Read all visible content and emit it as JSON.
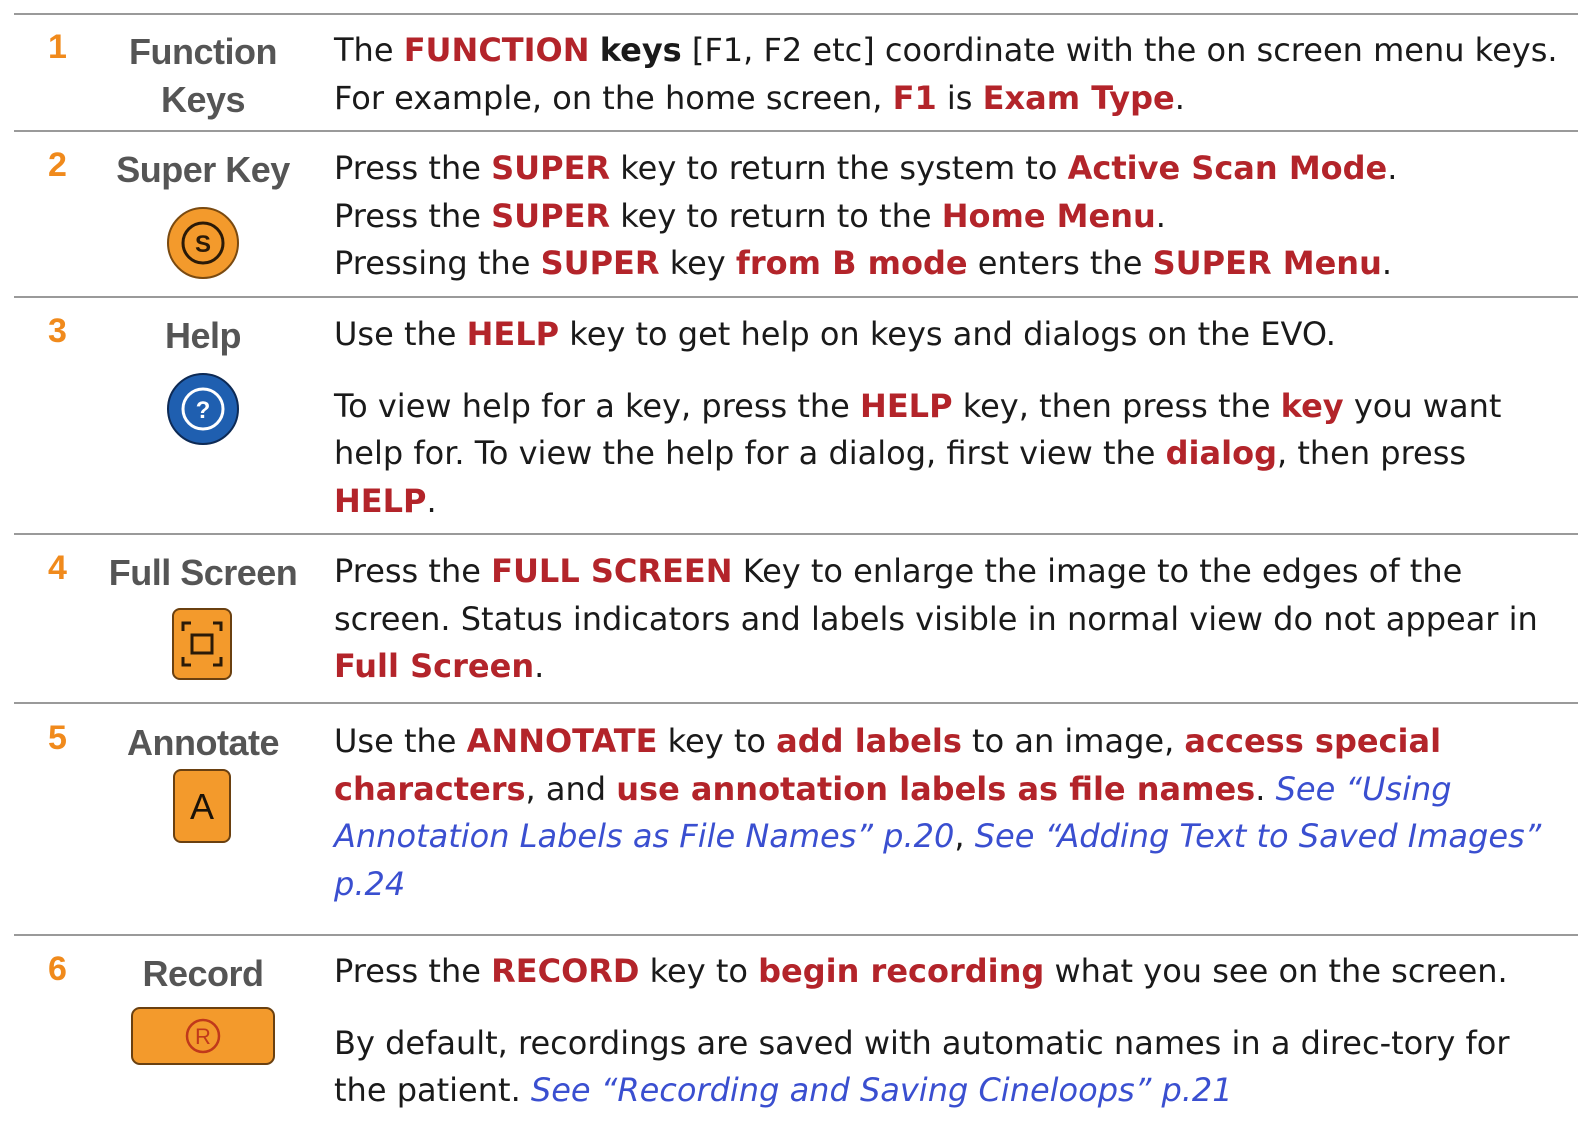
{
  "rows": [
    {
      "num": "1",
      "label_lines": [
        "Function",
        "Keys"
      ],
      "desc": [
        [
          {
            "t": "The ",
            "s": "n"
          },
          {
            "t": "FUNCTION",
            "s": "h"
          },
          {
            "t": " ",
            "s": "n"
          },
          {
            "t": "keys",
            "s": "b"
          },
          {
            "t": " [F1, F2 etc] coordinate with the on screen menu keys. For example, on the home screen, ",
            "s": "n"
          },
          {
            "t": "F1",
            "s": "h"
          },
          {
            "t": " is ",
            "s": "n"
          },
          {
            "t": "Exam Type",
            "s": "h"
          },
          {
            "t": ".",
            "s": "n"
          }
        ]
      ]
    },
    {
      "num": "2",
      "label_lines": [
        "Super Key"
      ],
      "icon": "super-key-icon",
      "icon_glyph": "S",
      "desc": [
        [
          {
            "t": "Press the ",
            "s": "n"
          },
          {
            "t": "SUPER",
            "s": "h"
          },
          {
            "t": " key to return the system to ",
            "s": "n"
          },
          {
            "t": "Active Scan Mode",
            "s": "h"
          },
          {
            "t": ".",
            "s": "n"
          },
          {
            "br": true
          },
          {
            "t": "Press the ",
            "s": "n"
          },
          {
            "t": "SUPER",
            "s": "h"
          },
          {
            "t": " key to return to the ",
            "s": "n"
          },
          {
            "t": "Home Menu",
            "s": "h"
          },
          {
            "t": ".",
            "s": "n"
          },
          {
            "br": true
          },
          {
            "t": "Pressing the ",
            "s": "n"
          },
          {
            "t": "SUPER",
            "s": "h"
          },
          {
            "t": " key ",
            "s": "n"
          },
          {
            "t": "from B mode",
            "s": "h"
          },
          {
            "t": " enters the ",
            "s": "n"
          },
          {
            "t": "SUPER Menu",
            "s": "h"
          },
          {
            "t": ".",
            "s": "n"
          }
        ]
      ]
    },
    {
      "num": "3",
      "label_lines": [
        "Help"
      ],
      "icon": "help-key-icon",
      "icon_glyph": "?",
      "desc": [
        [
          {
            "t": "Use the ",
            "s": "n"
          },
          {
            "t": "HELP",
            "s": "h"
          },
          {
            "t": " key to get help on keys and dialogs on the EVO.",
            "s": "n"
          }
        ],
        [
          {
            "t": "To view help for a key, press the ",
            "s": "n"
          },
          {
            "t": "HELP",
            "s": "h"
          },
          {
            "t": " key, then press the ",
            "s": "n"
          },
          {
            "t": "key",
            "s": "h"
          },
          {
            "t": " you want help for. To view the help for a dialog, first view the ",
            "s": "n"
          },
          {
            "t": "dialog",
            "s": "h"
          },
          {
            "t": ", then press ",
            "s": "n"
          },
          {
            "t": "HELP",
            "s": "h"
          },
          {
            "t": ".",
            "s": "n"
          }
        ]
      ]
    },
    {
      "num": "4",
      "label_lines": [
        "Full Screen"
      ],
      "icon": "full-screen-key-icon",
      "desc": [
        [
          {
            "t": "Press the ",
            "s": "n"
          },
          {
            "t": "FULL SCREEN",
            "s": "h"
          },
          {
            "t": " Key to enlarge the image to the edges of the screen. Status indicators and labels visible in normal view do not appear in ",
            "s": "n"
          },
          {
            "t": "Full Screen",
            "s": "h"
          },
          {
            "t": ".",
            "s": "n"
          }
        ]
      ]
    },
    {
      "num": "5",
      "label_lines": [
        "Annotate"
      ],
      "icon": "annotate-key-icon",
      "icon_glyph": "A",
      "desc": [
        [
          {
            "t": "Use the ",
            "s": "n"
          },
          {
            "t": "ANNOTATE",
            "s": "h"
          },
          {
            "t": " key to ",
            "s": "n"
          },
          {
            "t": "add labels",
            "s": "h"
          },
          {
            "t": " to an image, ",
            "s": "n"
          },
          {
            "t": "access special characters",
            "s": "h"
          },
          {
            "t": ", and ",
            "s": "n"
          },
          {
            "t": "use annotation labels as file names",
            "s": "h"
          },
          {
            "t": ". ",
            "s": "n"
          },
          {
            "t": "See “Using Annotation Labels as File Names” p.20",
            "s": "l"
          },
          {
            "t": ", ",
            "s": "n"
          },
          {
            "t": "See “Adding Text to Saved Images” p.24",
            "s": "l"
          }
        ]
      ]
    },
    {
      "num": "6",
      "label_lines": [
        "Record"
      ],
      "icon": "record-key-icon",
      "icon_glyph": "R",
      "desc": [
        [
          {
            "t": "Press the ",
            "s": "n"
          },
          {
            "t": "RECORD",
            "s": "h"
          },
          {
            "t": " key to ",
            "s": "n"
          },
          {
            "t": "begin recording",
            "s": "h"
          },
          {
            "t": " what you see on the screen.",
            "s": "n"
          }
        ],
        [
          {
            "t": "By default, recordings are saved with automatic names in a direc-tory for the patient. ",
            "s": "n"
          },
          {
            "t": "See “Recording and Saving Cineloops” p.21",
            "s": "l"
          }
        ]
      ]
    }
  ],
  "colors": {
    "number": "#f08a1c",
    "highlight": "#b3242a",
    "link": "#3a4fd0",
    "label": "#555555",
    "rule": "#9a9a9a",
    "key_orange": "#f39a2c",
    "key_blue": "#1f5fb0"
  }
}
